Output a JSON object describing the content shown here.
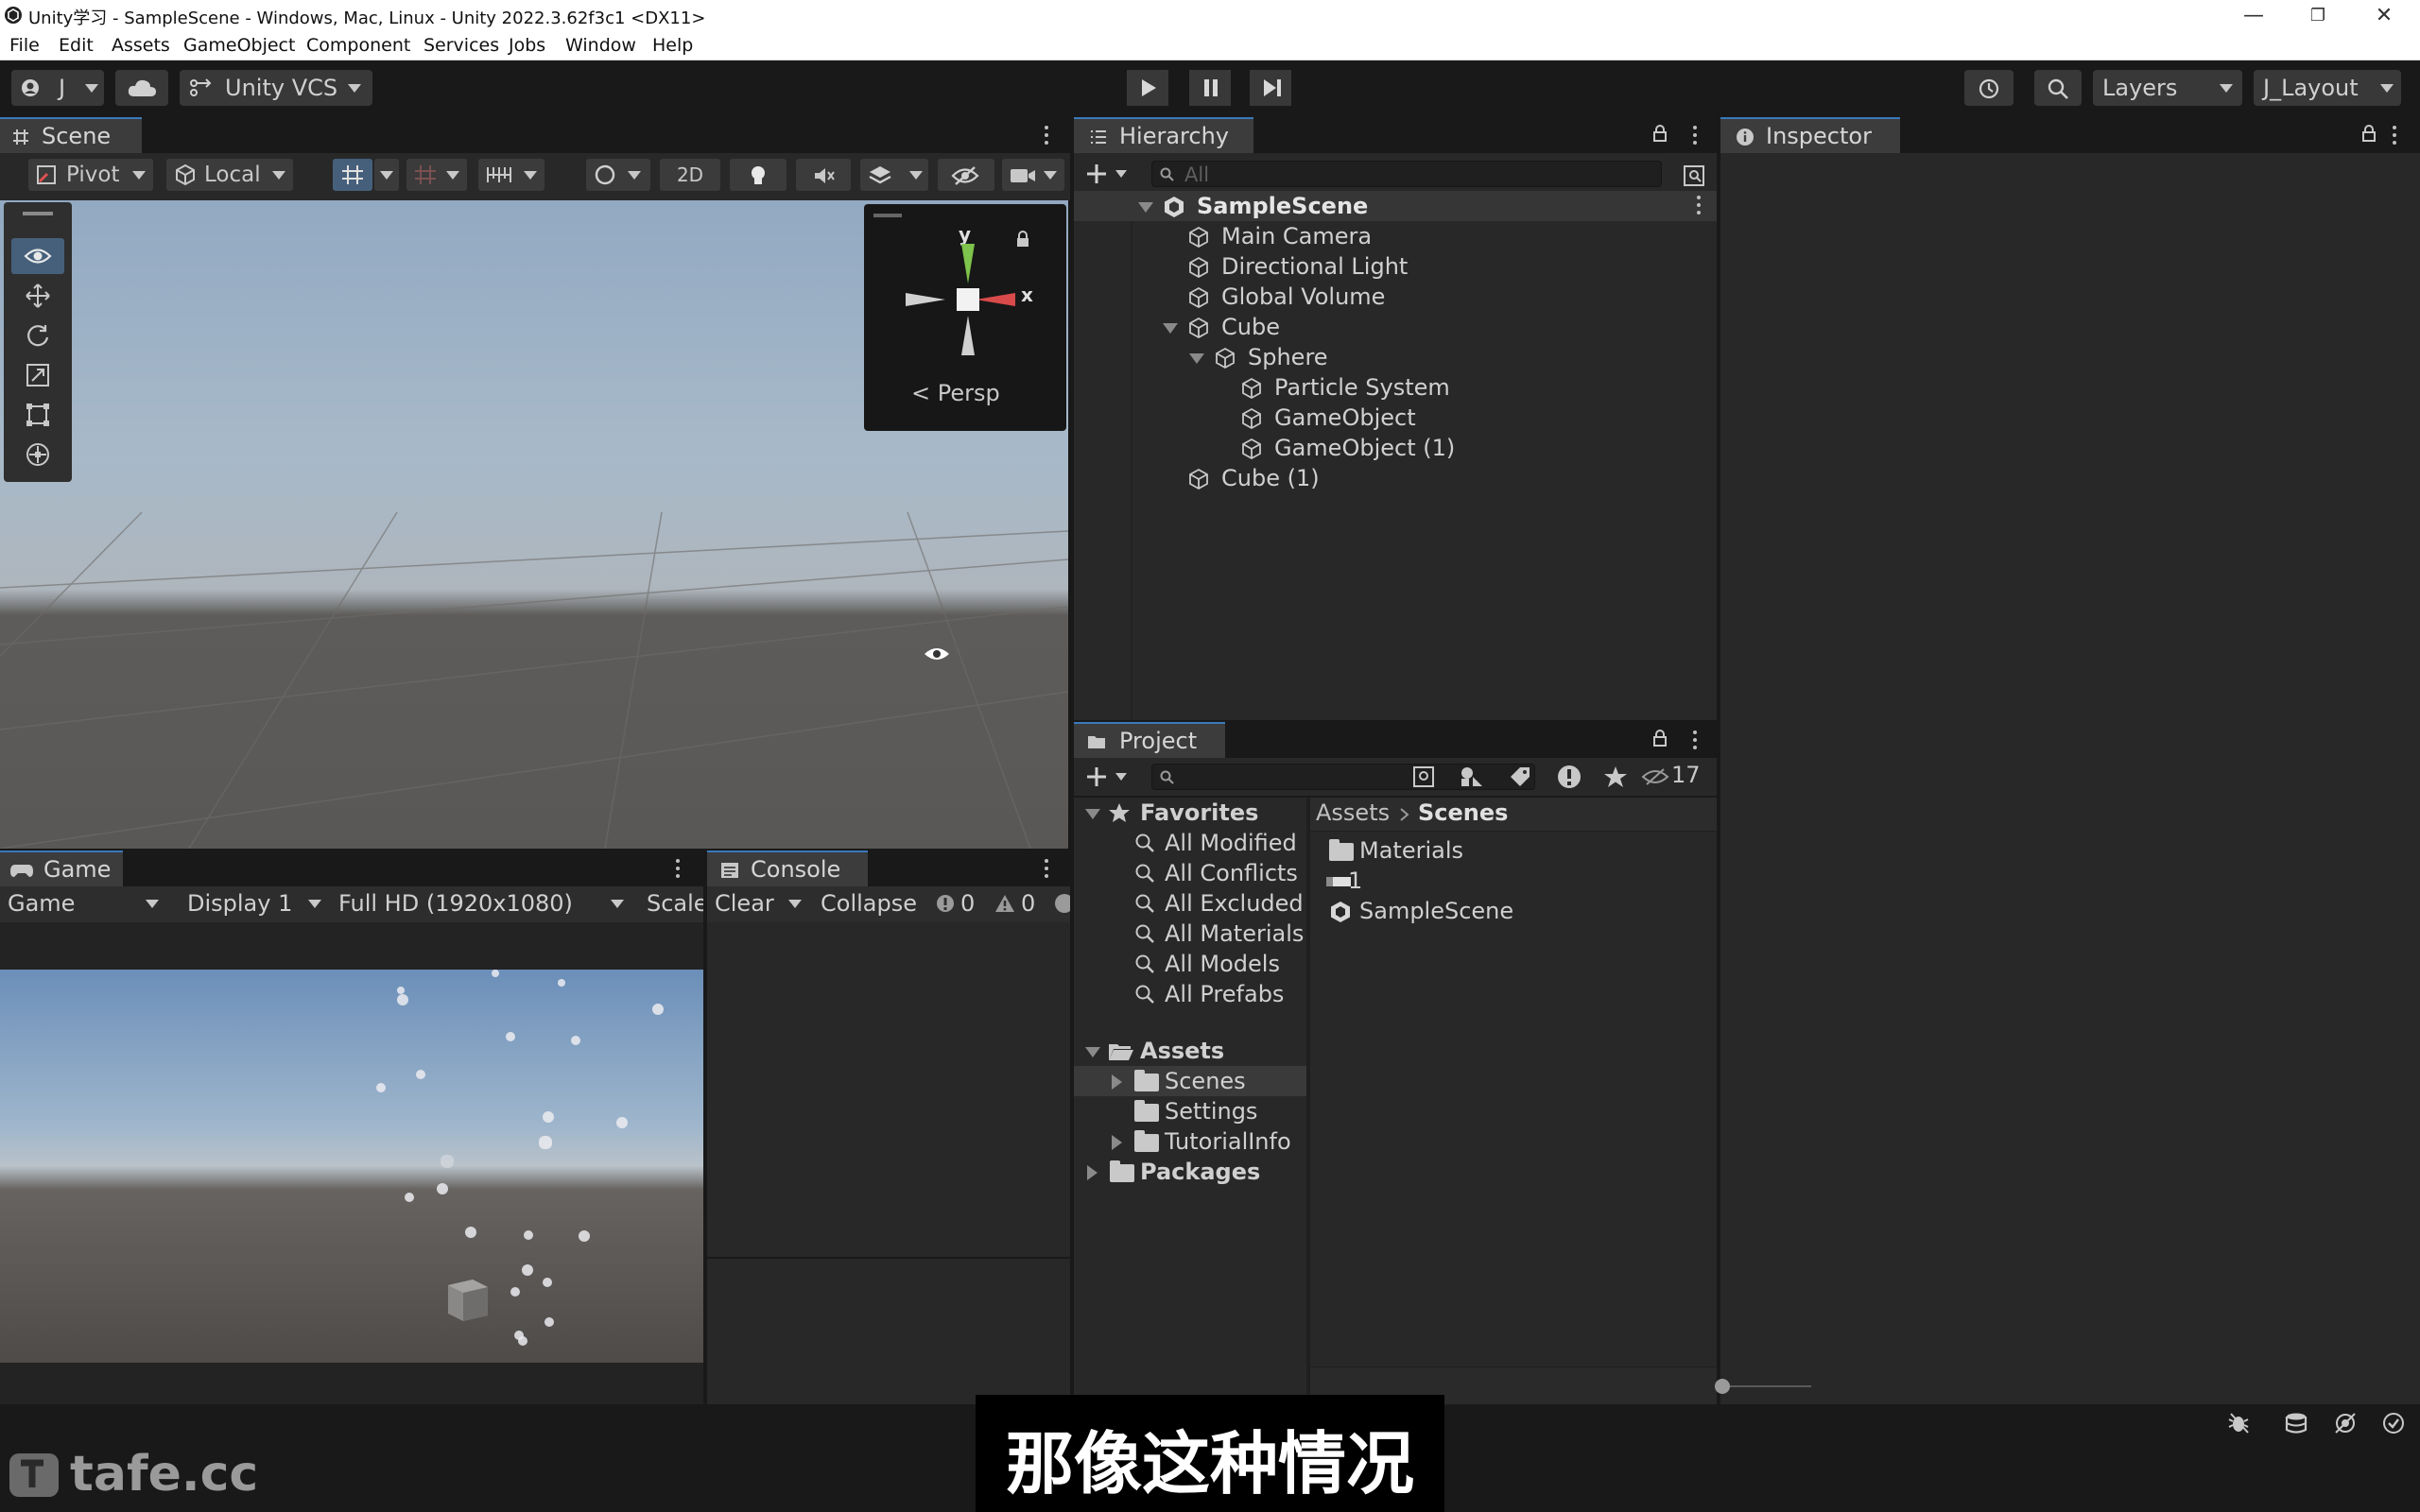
{
  "window": {
    "title": "Unity学习 - SampleScene - Windows, Mac, Linux - Unity 2022.3.62f3c1 <DX11>",
    "minimize": "—",
    "restore": "❐",
    "close": "✕"
  },
  "menu": [
    "File",
    "Edit",
    "Assets",
    "GameObject",
    "Component",
    "Services",
    "Jobs",
    "Window",
    "Help"
  ],
  "toolbar": {
    "account": "J",
    "vcs": "Unity VCS",
    "layers": "Layers",
    "layout": "J_Layout"
  },
  "scene": {
    "tab": "Scene",
    "pivot": "Pivot",
    "local": "Local",
    "mode_2d": "2D",
    "gizmo_y": "y",
    "gizmo_x": "x",
    "projection": "Persp"
  },
  "hierarchy": {
    "tab": "Hierarchy",
    "search_placeholder": "All",
    "scene_name": "SampleScene",
    "items": [
      {
        "name": "Main Camera"
      },
      {
        "name": "Directional Light"
      },
      {
        "name": "Global Volume"
      },
      {
        "name": "Cube"
      },
      {
        "name": "Sphere"
      },
      {
        "name": "Particle System"
      },
      {
        "name": "GameObject"
      },
      {
        "name": "GameObject (1)"
      },
      {
        "name": "Cube (1)"
      }
    ]
  },
  "inspector": {
    "tab": "Inspector"
  },
  "project": {
    "tab": "Project",
    "hidden_count": "17",
    "favorites_label": "Favorites",
    "favorites": [
      "All Modified",
      "All Conflicts",
      "All Excluded",
      "All Materials",
      "All Models",
      "All Prefabs"
    ],
    "assets_label": "Assets",
    "asset_folders": [
      "Scenes",
      "Settings",
      "TutorialInfo"
    ],
    "packages_label": "Packages",
    "breadcrumb": [
      "Assets",
      "Scenes"
    ],
    "files": [
      "Materials",
      "1",
      "SampleScene"
    ]
  },
  "game": {
    "tab": "Game",
    "mode": "Game",
    "display": "Display 1",
    "resolution": "Full HD (1920x1080)",
    "scale": "Scale"
  },
  "console": {
    "tab": "Console",
    "clear": "Clear",
    "collapse": "Collapse",
    "error_count": "0",
    "warning_count": "0"
  },
  "subtitle": "那像这种情况",
  "watermark": "tafe.cc"
}
